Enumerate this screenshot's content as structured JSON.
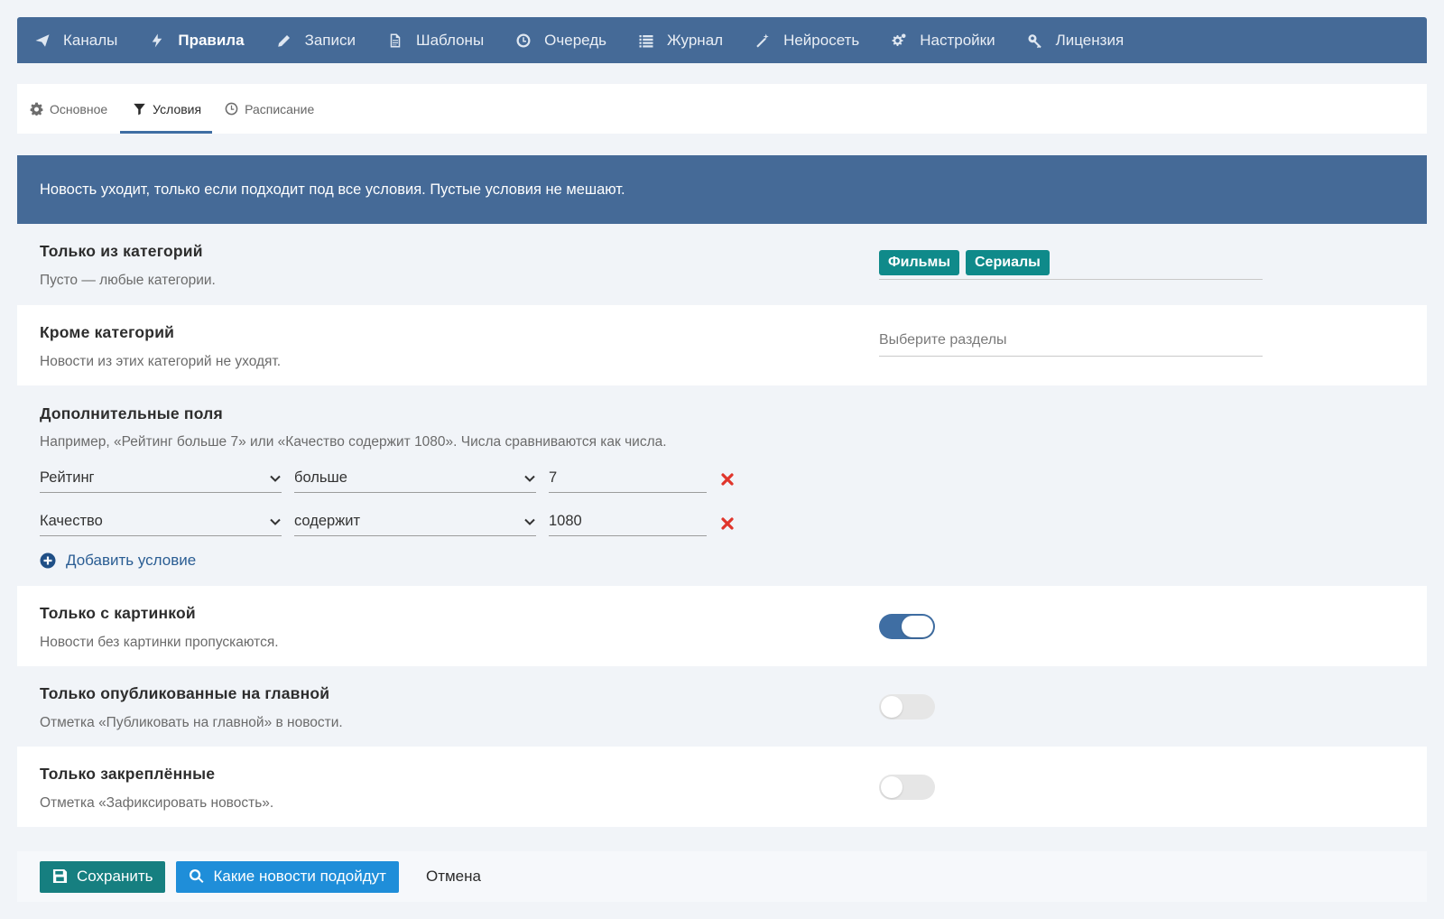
{
  "nav": {
    "items": [
      {
        "label": "Каналы",
        "icon": "paper-plane-icon"
      },
      {
        "label": "Правила",
        "icon": "bolt-icon",
        "active": true
      },
      {
        "label": "Записи",
        "icon": "pencil-icon"
      },
      {
        "label": "Шаблоны",
        "icon": "document-icon"
      },
      {
        "label": "Очередь",
        "icon": "clock-icon"
      },
      {
        "label": "Журнал",
        "icon": "list-icon"
      },
      {
        "label": "Нейросеть",
        "icon": "magic-wand-icon"
      },
      {
        "label": "Настройки",
        "icon": "gears-icon"
      },
      {
        "label": "Лицензия",
        "icon": "key-icon"
      }
    ]
  },
  "subtabs": {
    "items": [
      {
        "label": "Основное",
        "icon": "gear-icon"
      },
      {
        "label": "Условия",
        "icon": "filter-icon",
        "active": true
      },
      {
        "label": "Расписание",
        "icon": "clock-icon"
      }
    ]
  },
  "banner": {
    "text": "Новость уходит, только если подходит под все условия. Пустые условия не мешают."
  },
  "sections": {
    "include_categories": {
      "title": "Только из категорий",
      "desc": "Пусто — любые категории.",
      "tags": [
        "Фильмы",
        "Сериалы"
      ]
    },
    "exclude_categories": {
      "title": "Кроме категорий",
      "desc": "Новости из этих категорий не уходят.",
      "placeholder": "Выберите разделы"
    },
    "extra_fields": {
      "title": "Дополнительные поля",
      "desc": "Например, «Рейтинг больше 7» или «Качество содержит 1080». Числа сравниваются как числа.",
      "rows": [
        {
          "field": "Рейтинг",
          "op": "больше",
          "value": "7"
        },
        {
          "field": "Качество",
          "op": "содержит",
          "value": "1080"
        }
      ],
      "add_label": "Добавить условие"
    },
    "with_image": {
      "title": "Только с картинкой",
      "desc": "Новости без картинки пропускаются.",
      "enabled": true
    },
    "on_main": {
      "title": "Только опубликованные на главной",
      "desc": "Отметка «Публиковать на главной» в новости.",
      "enabled": false
    },
    "pinned": {
      "title": "Только закреплённые",
      "desc": "Отметка «Зафиксировать новость».",
      "enabled": false
    }
  },
  "footer": {
    "save_label": "Сохранить",
    "preview_label": "Какие новости подойдут",
    "cancel_label": "Отмена"
  },
  "colors": {
    "nav_bg": "#456a97",
    "tag_bg": "#0f8a8a",
    "save_bg": "#167f80",
    "preview_bg": "#1f8ed9",
    "remove": "#e0352b",
    "toggle_on": "#3f6ea3"
  }
}
